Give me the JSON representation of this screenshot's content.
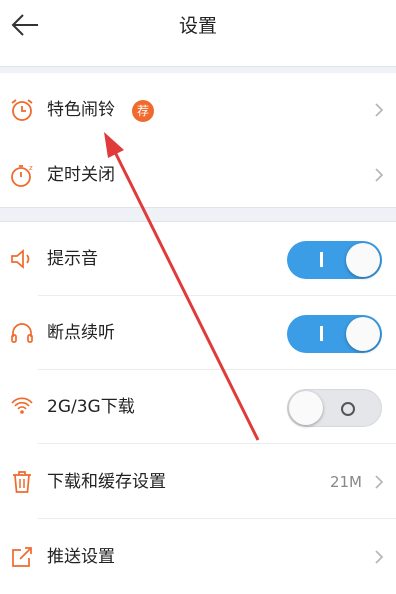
{
  "header": {
    "title": "设置"
  },
  "sections": [
    {
      "items": [
        {
          "label": "特色闹铃",
          "badge": "荐",
          "icon": "alarm-clock-icon",
          "control": "chevron"
        },
        {
          "label": "定时关闭",
          "icon": "timer-icon",
          "control": "chevron"
        }
      ]
    },
    {
      "items": [
        {
          "label": "提示音",
          "icon": "speaker-icon",
          "control": "toggle",
          "on": true
        },
        {
          "label": "断点续听",
          "icon": "headphones-icon",
          "control": "toggle",
          "on": true
        },
        {
          "label": "2G/3G下载",
          "icon": "signal-icon",
          "control": "toggle",
          "on": false
        },
        {
          "label": "下载和缓存设置",
          "value": "21M",
          "icon": "trash-icon",
          "control": "chevron"
        },
        {
          "label": "推送设置",
          "icon": "share-icon",
          "control": "chevron"
        }
      ]
    }
  ],
  "colors": {
    "accent": "#ef6a2c",
    "toggle_on": "#3a9de6",
    "annotation_arrow": "#e03a3a"
  }
}
